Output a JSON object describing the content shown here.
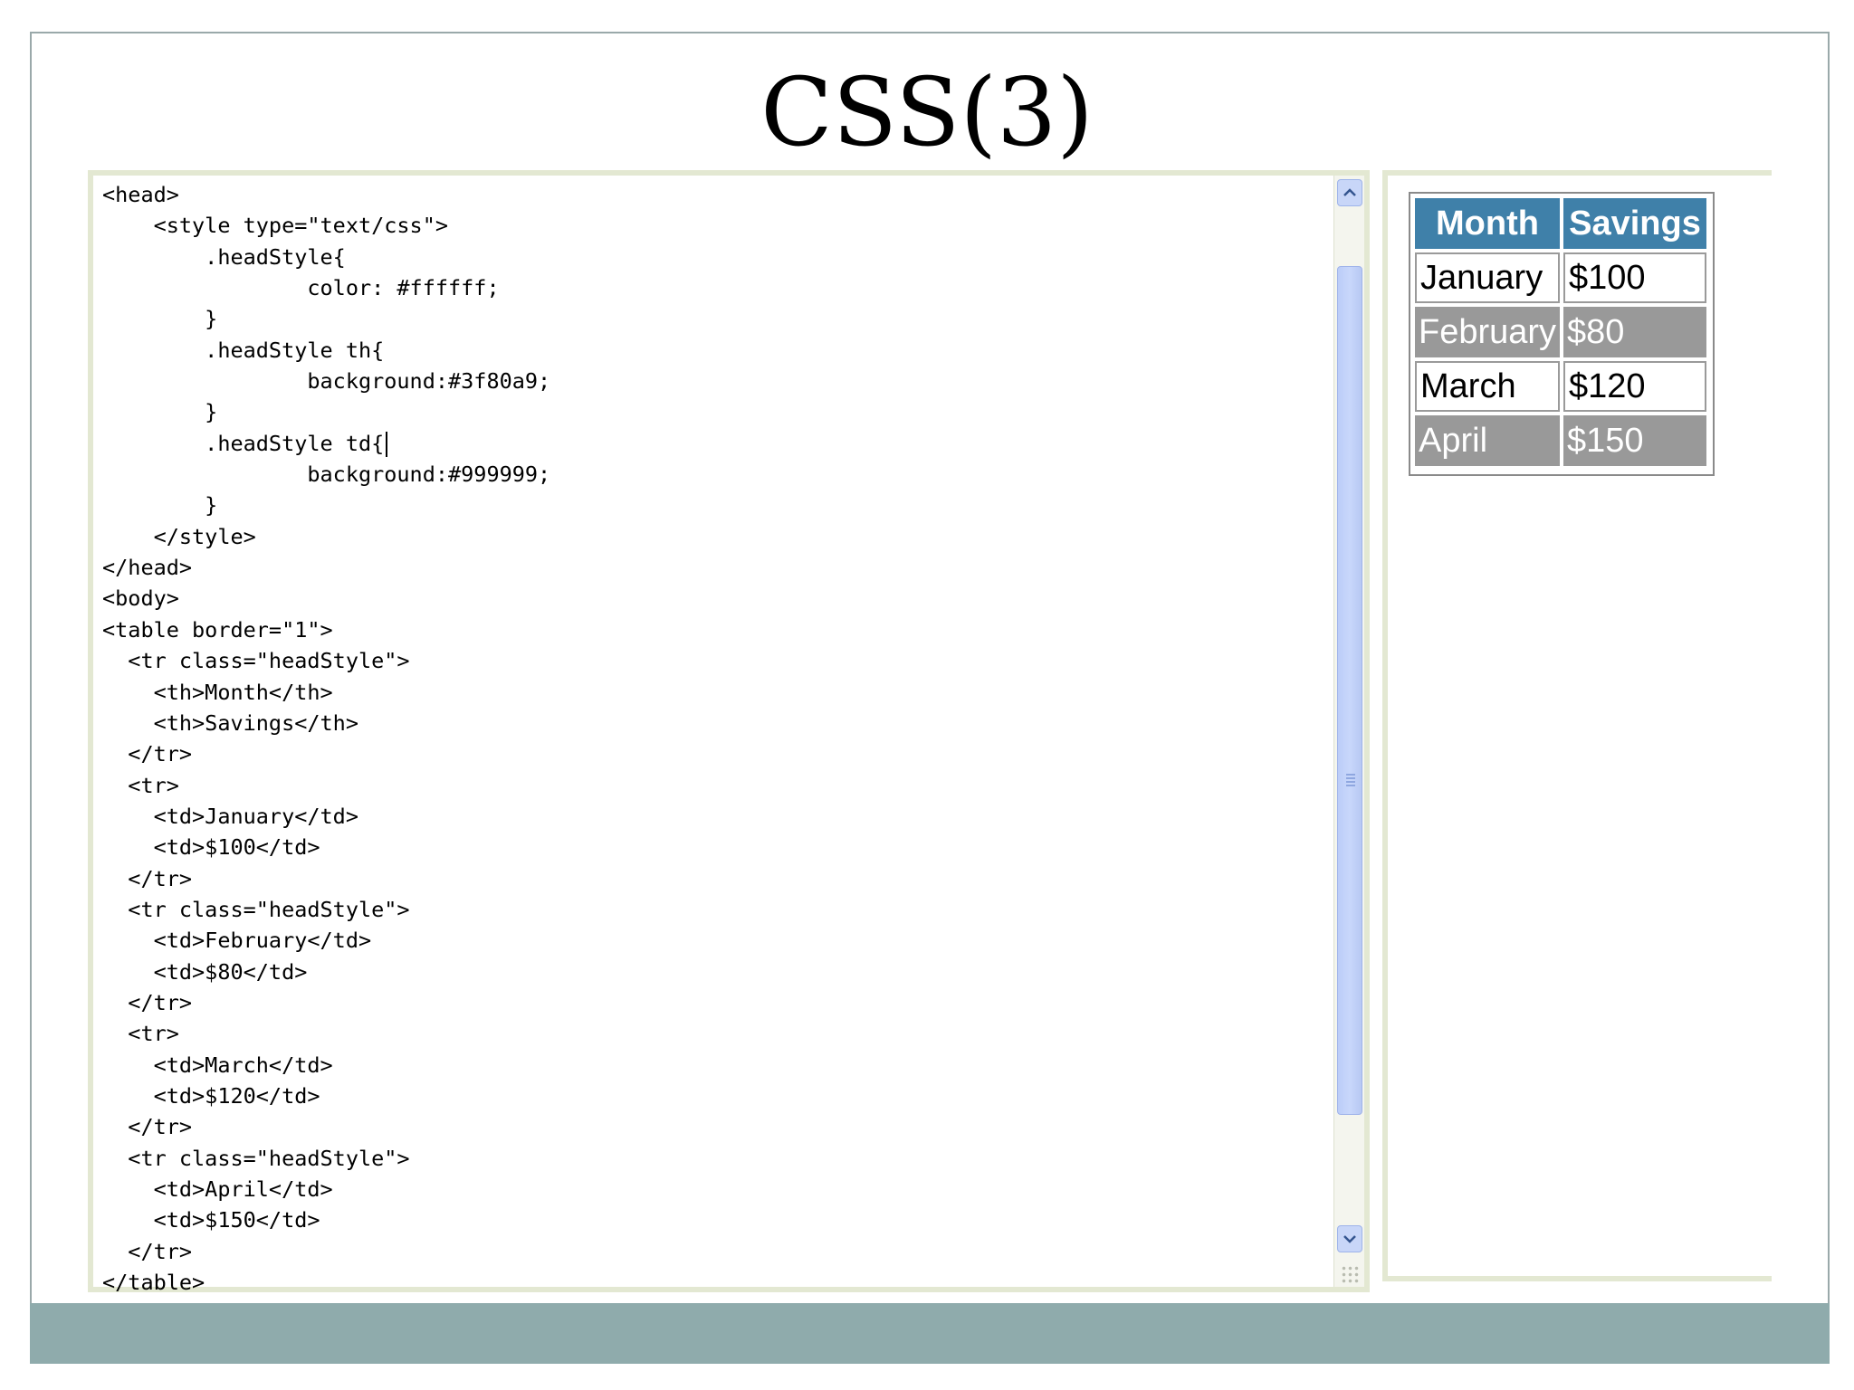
{
  "slide": {
    "title": "CSS(3)"
  },
  "editor": {
    "code_lines": [
      "<head>",
      "    <style type=\"text/css\">",
      "        .headStyle{",
      "                color: #ffffff;",
      "        }",
      "        .headStyle th{",
      "                background:#3f80a9;",
      "        }",
      "        .headStyle td{",
      "                background:#999999;",
      "        }",
      "    </style>",
      "</head>",
      "<body>",
      "<table border=\"1\">",
      "  <tr class=\"headStyle\">",
      "    <th>Month</th>",
      "    <th>Savings</th>",
      "  </tr>",
      "  <tr>",
      "    <td>January</td>",
      "    <td>$100</td>",
      "  </tr>",
      "  <tr class=\"headStyle\">",
      "    <td>February</td>",
      "    <td>$80</td>",
      "  </tr>",
      "  <tr>",
      "    <td>March</td>",
      "    <td>$120</td>",
      "  </tr>",
      "  <tr class=\"headStyle\">",
      "    <td>April</td>",
      "    <td>$150</td>",
      "  </tr>",
      "</table>"
    ],
    "scroll_up_icon": "chevron-up-icon",
    "scroll_down_icon": "chevron-down-icon"
  },
  "preview_table": {
    "header": [
      "Month",
      "Savings"
    ],
    "rows": [
      {
        "month": "January",
        "savings": "$100",
        "styled": false
      },
      {
        "month": "February",
        "savings": "$80",
        "styled": true
      },
      {
        "month": "March",
        "savings": "$120",
        "styled": false
      },
      {
        "month": "April",
        "savings": "$150",
        "styled": true
      }
    ]
  },
  "colors": {
    "header_bg": "#3f80a9",
    "styled_row_bg": "#999999",
    "footer_bar": "#8fabac"
  }
}
